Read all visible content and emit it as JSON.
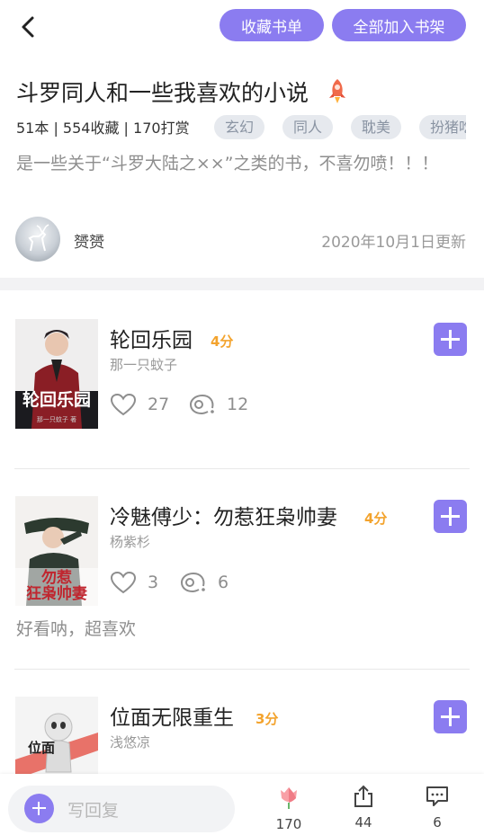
{
  "header": {
    "favorite_button": "收藏书单",
    "add_all_button": "全部加入书架"
  },
  "booklist": {
    "title": "斗罗同人和一些我喜欢的小说",
    "stats": "51本 | 554收藏 | 170打赏",
    "tags": [
      "玄幻",
      "同人",
      "耽美",
      "扮猪吃"
    ],
    "description": "是一些关于“斗罗大陆之××”之类的书，不喜勿喷！！！",
    "author": "赟赟",
    "updated": "2020年10月1日更新"
  },
  "books": [
    {
      "name": "轮回乐园",
      "score": "4分",
      "author": "那一只蚊子",
      "likes": "27",
      "comments": "12",
      "note": ""
    },
    {
      "name": "冷魅傅少：勿惹狂枭帅妻",
      "score": "4分",
      "author": "杨紫杉",
      "likes": "3",
      "comments": "6",
      "note": "好看呐，超喜欢"
    },
    {
      "name": "位面无限重生",
      "score": "3分",
      "author": "浅悠凉",
      "likes": "",
      "comments": "",
      "note": ""
    }
  ],
  "footer": {
    "reply_placeholder": "写回复",
    "flowers": "170",
    "shares": "44",
    "comments": "6"
  },
  "colors": {
    "accent": "#8b7cf0",
    "score": "#f3a32d"
  },
  "icons": [
    "back-arrow-icon",
    "rocket-icon",
    "heart-icon",
    "comment-bubble-icon",
    "plus-icon",
    "tulip-icon",
    "share-icon",
    "message-icon"
  ]
}
